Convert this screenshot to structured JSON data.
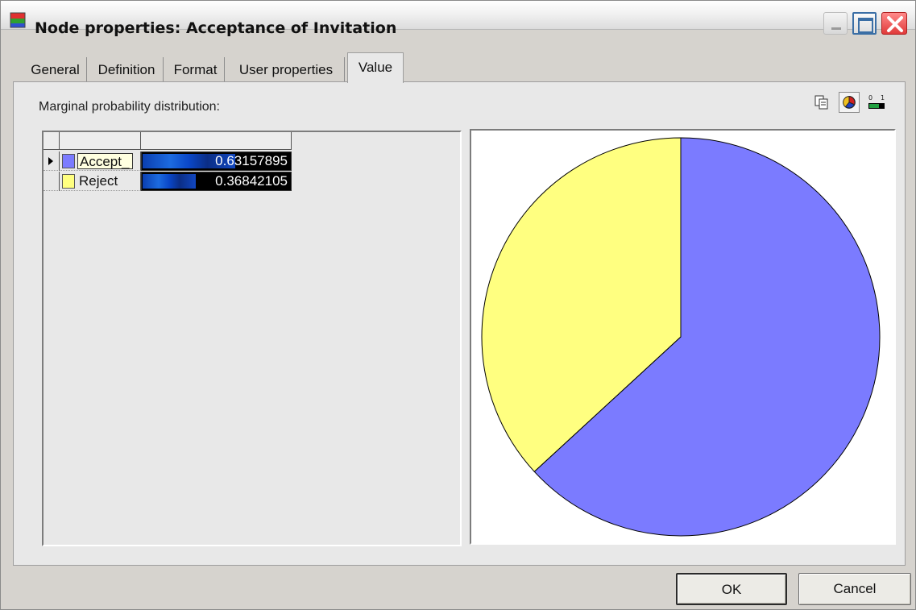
{
  "window": {
    "title": "Node properties: Acceptance of  Invitation"
  },
  "tabs": [
    {
      "label": "General",
      "active": false
    },
    {
      "label": "Definition",
      "active": false
    },
    {
      "label": "Format",
      "active": false
    },
    {
      "label": "User properties",
      "active": false
    },
    {
      "label": "Value",
      "active": true
    }
  ],
  "panel": {
    "label": "Marginal probability distribution:",
    "toolbar_icons": [
      "copy-icon",
      "pie-chart-icon",
      "bar-scale-icon"
    ]
  },
  "grid": {
    "rows": [
      {
        "state": "Accept_",
        "value": "0.63157895",
        "probability": 0.63157895,
        "color": "#7b7bff",
        "selected": true
      },
      {
        "state": "Reject",
        "value": "0.36842105",
        "probability": 0.36842105,
        "color": "#ffff80",
        "selected": false
      }
    ]
  },
  "chart_data": {
    "type": "pie",
    "categories": [
      "Accept_",
      "Reject"
    ],
    "values": [
      0.63157895,
      0.36842105
    ],
    "colors": [
      "#7b7bff",
      "#ffff80"
    ],
    "title": ""
  },
  "buttons": {
    "ok": "OK",
    "cancel": "Cancel"
  }
}
